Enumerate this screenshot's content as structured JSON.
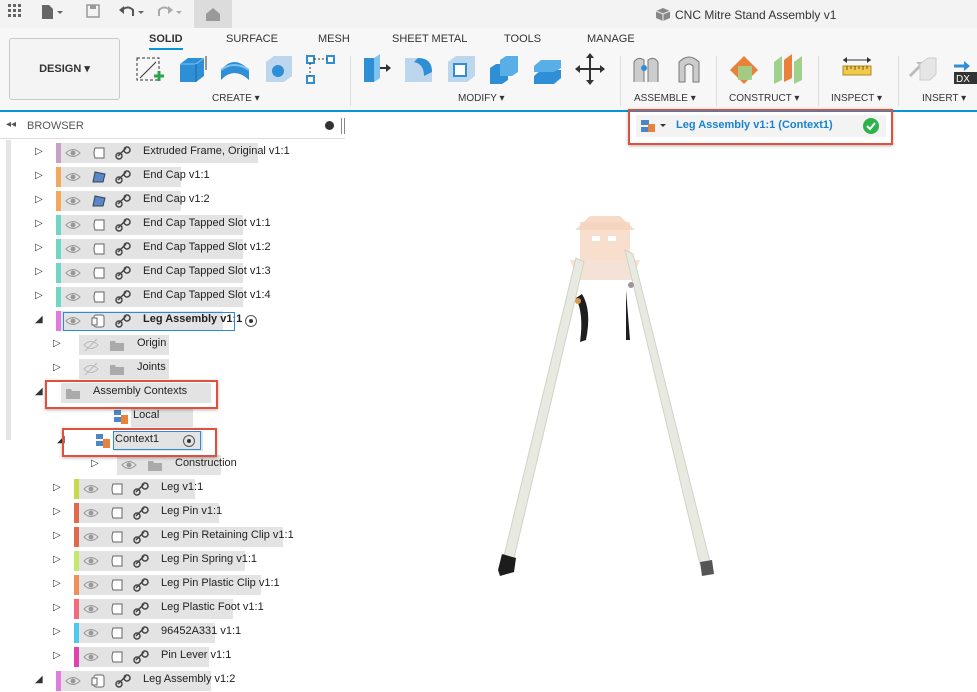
{
  "title_bar": {
    "document_title": "CNC Mitre Stand Assembly v1"
  },
  "ribbon": {
    "workspace_button": "DESIGN",
    "tabs": [
      "SOLID",
      "SURFACE",
      "MESH",
      "SHEET METAL",
      "TOOLS",
      "MANAGE"
    ],
    "active_tab": "SOLID",
    "groups": [
      "CREATE",
      "MODIFY",
      "ASSEMBLE",
      "CONSTRUCT",
      "INSPECT",
      "INSERT"
    ]
  },
  "browser": {
    "title": "BROWSER",
    "items": [
      {
        "name": "Extruded Frame, Original v1:1",
        "color": "#c7a0c7"
      },
      {
        "name": "End Cap v1:1",
        "color": "#f3a85b"
      },
      {
        "name": "End Cap v1:2",
        "color": "#f3a85b"
      },
      {
        "name": "End Cap Tapped Slot v1:1",
        "color": "#6fd6c3"
      },
      {
        "name": "End Cap Tapped Slot v1:2",
        "color": "#6fd6c3"
      },
      {
        "name": "End Cap Tapped Slot v1:3",
        "color": "#6fd6c3"
      },
      {
        "name": "End Cap Tapped Slot v1:4",
        "color": "#6fd6c3"
      },
      {
        "name": "Leg Assembly v1:1",
        "color": "#e07be0"
      },
      {
        "name": "Origin"
      },
      {
        "name": "Joints"
      },
      {
        "name": "Assembly Contexts"
      },
      {
        "name": "Local"
      },
      {
        "name": "Context1"
      },
      {
        "name": "Construction"
      },
      {
        "name": "Leg v1:1",
        "color": "#c9d94a"
      },
      {
        "name": "Leg Pin v1:1",
        "color": "#e06a4e"
      },
      {
        "name": "Leg Pin Retaining Clip v1:1",
        "color": "#e06a4e"
      },
      {
        "name": "Leg Pin Spring v1:1",
        "color": "#c6e86a"
      },
      {
        "name": "Leg Pin Plastic Clip v1:1",
        "color": "#f0905a"
      },
      {
        "name": "Leg Plastic Foot v1:1",
        "color": "#ef6a7a"
      },
      {
        "name": "96452A331 v1:1",
        "color": "#4fc8ee"
      },
      {
        "name": "Pin Lever v1:1",
        "color": "#e042b0"
      },
      {
        "name": "Leg Assembly v1:2",
        "color": "#e07be0"
      }
    ]
  },
  "context_badge": {
    "label": "Leg Assembly v1:1 (Context1)",
    "status_color": "#2db34a"
  },
  "colors": {
    "accent": "#0696d7",
    "highlight_box": "#e0513d"
  }
}
